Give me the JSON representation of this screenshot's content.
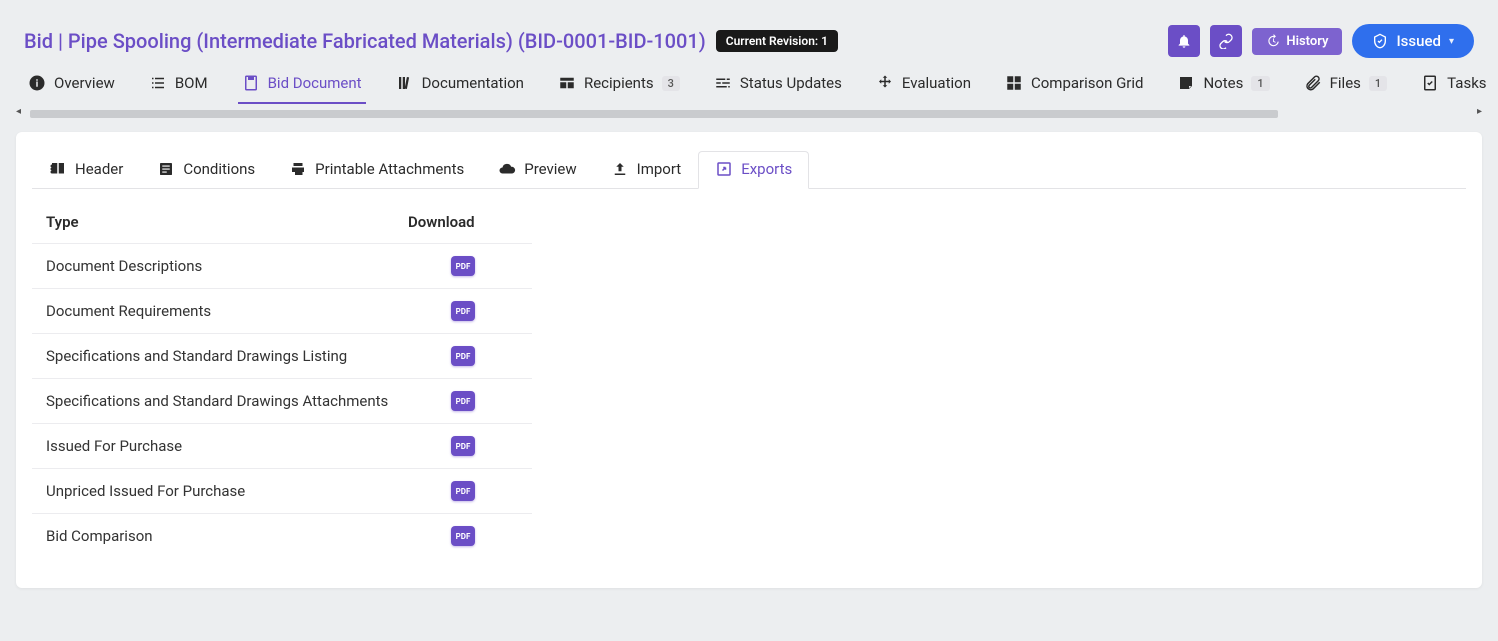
{
  "header": {
    "title": "Bid | Pipe Spooling (Intermediate Fabricated Materials) (BID-0001-BID-1001)",
    "revision_label": "Current Revision: 1",
    "history_label": "History",
    "issued_label": "Issued"
  },
  "main_tabs": [
    {
      "label": "Overview"
    },
    {
      "label": "BOM"
    },
    {
      "label": "Bid Document"
    },
    {
      "label": "Documentation"
    },
    {
      "label": "Recipients",
      "count": "3"
    },
    {
      "label": "Status Updates"
    },
    {
      "label": "Evaluation"
    },
    {
      "label": "Comparison Grid"
    },
    {
      "label": "Notes",
      "count": "1"
    },
    {
      "label": "Files",
      "count": "1"
    },
    {
      "label": "Tasks"
    }
  ],
  "sub_tabs": [
    {
      "label": "Header"
    },
    {
      "label": "Conditions"
    },
    {
      "label": "Printable Attachments"
    },
    {
      "label": "Preview"
    },
    {
      "label": "Import"
    },
    {
      "label": "Exports"
    }
  ],
  "export_table": {
    "col_type": "Type",
    "col_download": "Download",
    "pdf_label": "PDF",
    "rows": [
      {
        "type": "Document Descriptions"
      },
      {
        "type": "Document Requirements"
      },
      {
        "type": "Specifications and Standard Drawings Listing"
      },
      {
        "type": "Specifications and Standard Drawings Attachments"
      },
      {
        "type": "Issued For Purchase"
      },
      {
        "type": "Unpriced Issued For Purchase"
      },
      {
        "type": "Bid Comparison"
      }
    ]
  }
}
